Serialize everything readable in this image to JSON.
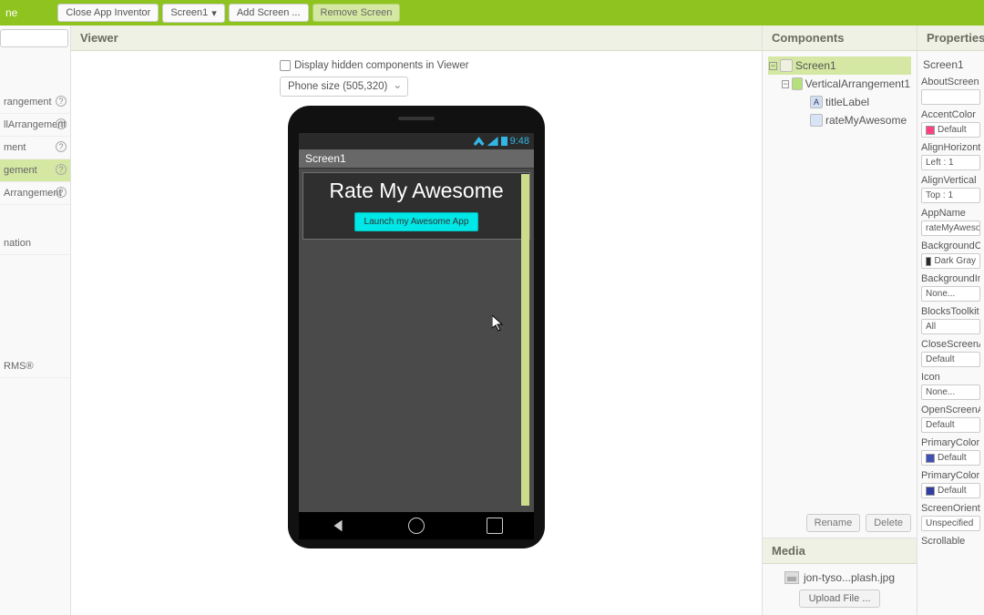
{
  "topbar": {
    "title": "ne",
    "close": "Close App Inventor",
    "screen_selector": "Screen1",
    "add_screen": "Add Screen ...",
    "remove_screen": "Remove Screen"
  },
  "panels": {
    "viewer": "Viewer",
    "components": "Components",
    "media": "Media",
    "properties": "Properties"
  },
  "palette_items": [
    "rangement",
    "llArrangement",
    "ment",
    "gement",
    "Arrangement",
    "nation",
    "RMS®"
  ],
  "viewer": {
    "hidden_label": "Display hidden components in Viewer",
    "size_selector": "Phone size (505,320)",
    "status_time": "9:48",
    "screen_title": "Screen1",
    "app_title": "Rate My Awesome",
    "launch_button": "Launch my Awesome App"
  },
  "components": {
    "root": "Screen1",
    "va": "VerticalArrangement1",
    "title_label": "titleLabel",
    "rate_comp": "rateMyAwesome",
    "rename": "Rename",
    "delete": "Delete"
  },
  "media": {
    "file": "jon-tyso...plash.jpg",
    "upload": "Upload File ..."
  },
  "properties": {
    "screen_name": "Screen1",
    "about": {
      "label": "AboutScreen"
    },
    "accent": {
      "label": "AccentColor",
      "value": "Default"
    },
    "alignh": {
      "label": "AlignHorizontal",
      "value": "Left : 1"
    },
    "alignv": {
      "label": "AlignVertical",
      "value": "Top : 1"
    },
    "appname": {
      "label": "AppName",
      "value": "rateMyAwesome"
    },
    "bgcolor": {
      "label": "BackgroundColo",
      "value": "Dark Gray"
    },
    "bgimage": {
      "label": "BackgroundIma",
      "value": "None..."
    },
    "blocks": {
      "label": "BlocksToolkit",
      "value": "All"
    },
    "closeanim": {
      "label": "CloseScreenAni",
      "value": "Default"
    },
    "icon": {
      "label": "Icon",
      "value": "None..."
    },
    "openanim": {
      "label": "OpenScreenAni",
      "value": "Default"
    },
    "primary": {
      "label": "PrimaryColor",
      "value": "Default"
    },
    "primarydark": {
      "label": "PrimaryColorDa",
      "value": "Default"
    },
    "orientation": {
      "label": "ScreenOrientati",
      "value": "Unspecified"
    },
    "scrollable": {
      "label": "Scrollable"
    }
  }
}
